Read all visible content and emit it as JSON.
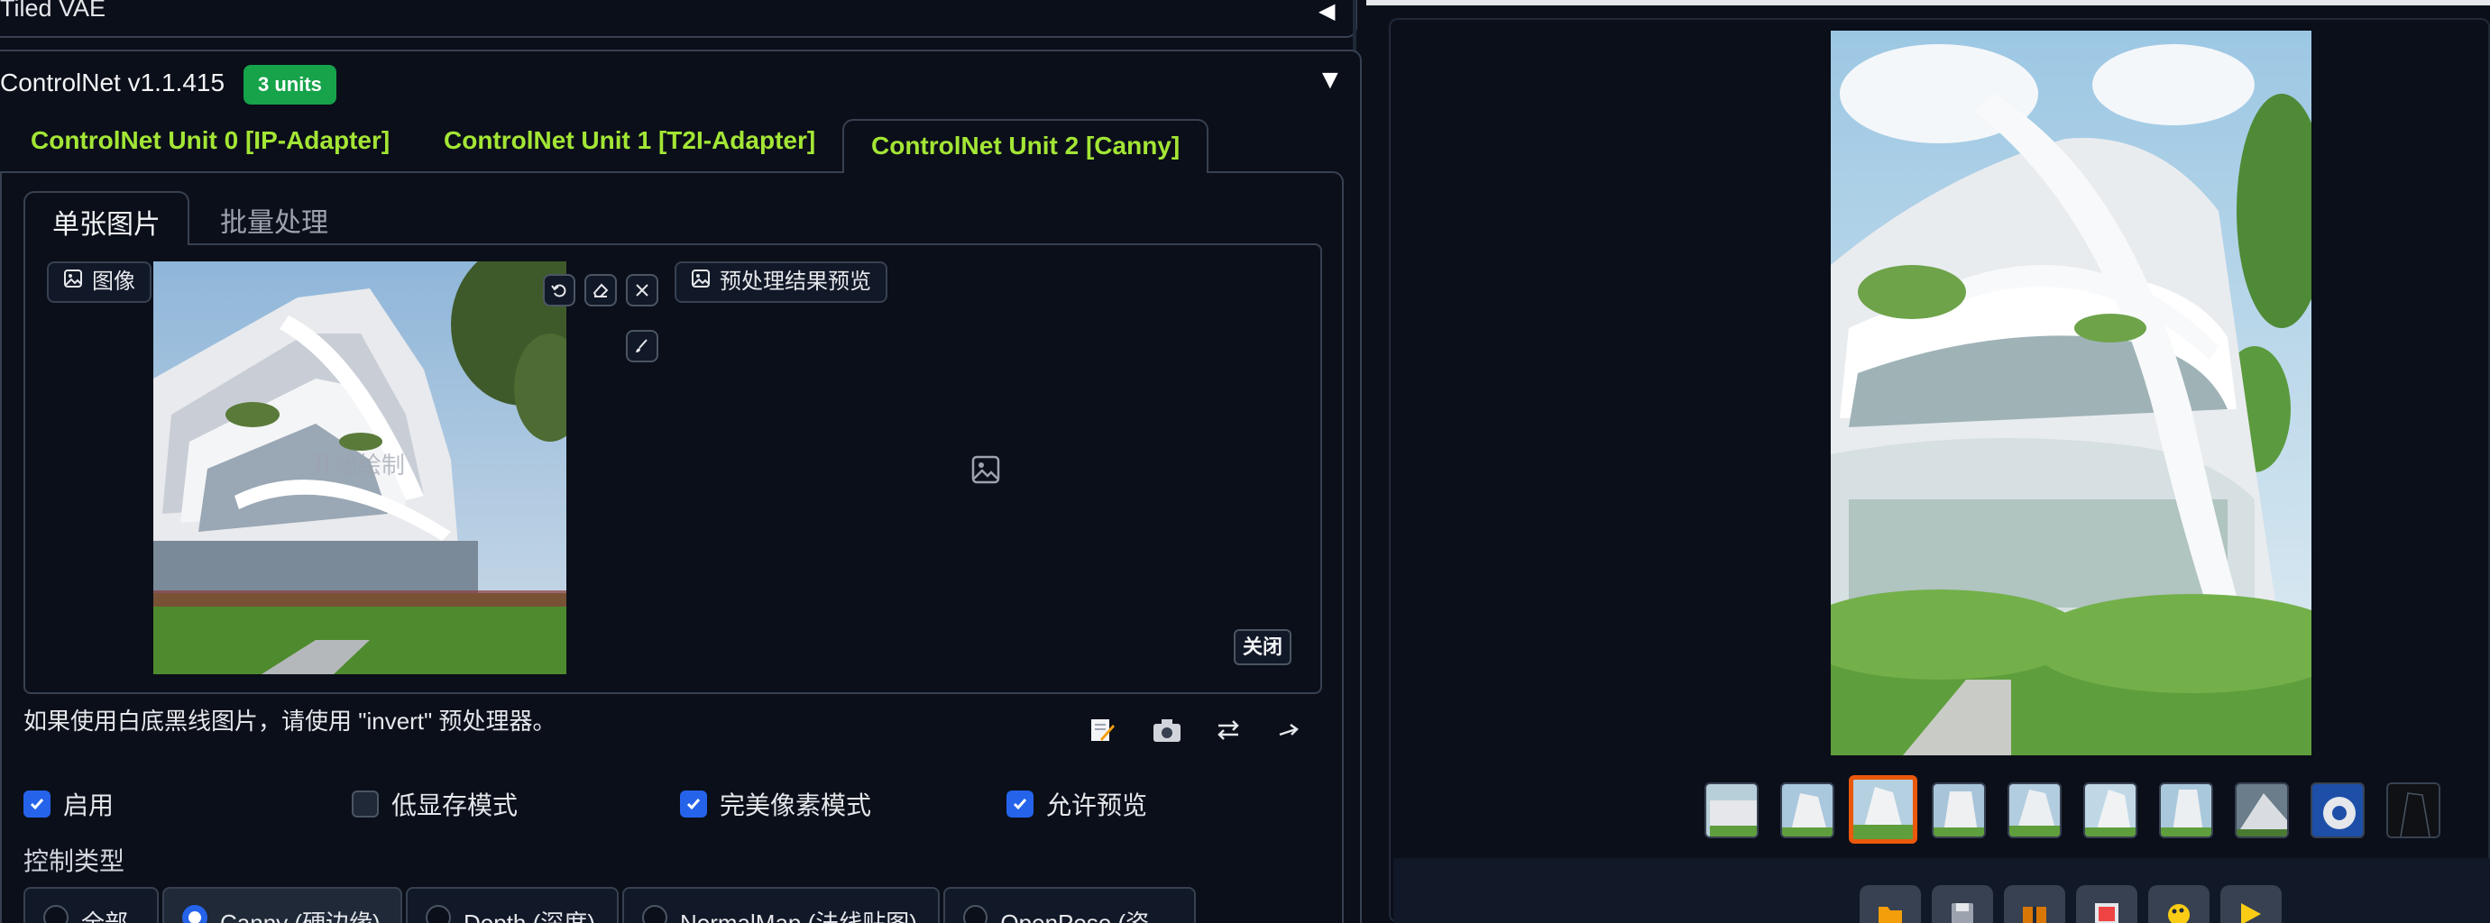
{
  "vae": {
    "title": "Tiled VAE"
  },
  "controlnet": {
    "title": "ControlNet v1.1.415",
    "badge": "3 units",
    "units": [
      {
        "label": "ControlNet Unit 0 [IP-Adapter]"
      },
      {
        "label": "ControlNet Unit 1 [T2I-Adapter]"
      },
      {
        "label": "ControlNet Unit 2 [Canny]"
      }
    ],
    "active_unit": 2,
    "subtabs": [
      "单张图片",
      "批量处理"
    ],
    "image_label": "图像",
    "canvas_watermark": "开始绘制",
    "preview_label": "预处理结果预览",
    "close_label": "关闭",
    "hint": "如果使用白底黑线图片，请使用 \"invert\" 预处理器。",
    "checkboxes": [
      {
        "label": "启用",
        "checked": true
      },
      {
        "label": "低显存模式",
        "checked": false
      },
      {
        "label": "完美像素模式",
        "checked": true
      },
      {
        "label": "允许预览",
        "checked": true
      }
    ],
    "control_type_label": "控制类型",
    "control_types": [
      {
        "label": "全部",
        "selected": false
      },
      {
        "label": "Canny (硬边缘)",
        "selected": true
      },
      {
        "label": "Depth (深度)",
        "selected": false
      },
      {
        "label": "NormalMap (法线贴图)",
        "selected": false
      },
      {
        "label": "OpenPose (姿态)",
        "selected": false
      }
    ]
  },
  "gallery": {
    "thumbnail_count": 10,
    "selected_index": 2
  },
  "colors": {
    "accent_green": "#a3e635",
    "badge_green": "#16a34a",
    "checkbox_blue": "#2563eb",
    "selection_orange": "#ea580c",
    "background": "#0b0f19"
  }
}
